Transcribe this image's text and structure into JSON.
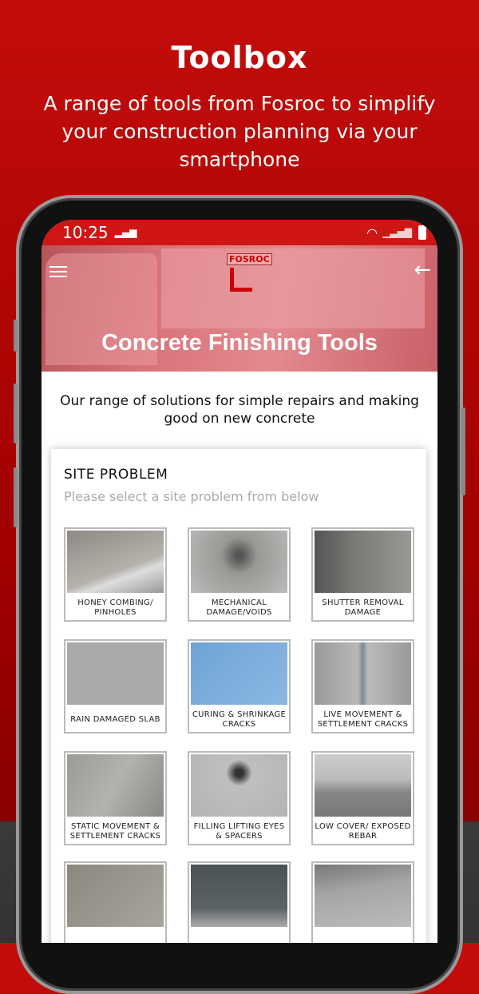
{
  "promo": {
    "title": "Toolbox",
    "subtitle": "A range of tools from Fosroc to simplify your construction planning via your smartphone"
  },
  "status_bar": {
    "time": "10:25"
  },
  "header": {
    "title": "Concrete Finishing Tools",
    "logo_text": "FOSROC",
    "menu_icon": "hamburger-icon",
    "back_icon": "arrow-left-icon"
  },
  "intro": "Our range of solutions for simple repairs and making good on new concrete",
  "site_problem": {
    "heading": "SITE PROBLEM",
    "hint": "Please select a site problem from below",
    "items": [
      {
        "label": "HONEY COMBING/ PINHOLES"
      },
      {
        "label": "MECHANICAL DAMAGE/VOIDS"
      },
      {
        "label": "SHUTTER REMOVAL DAMAGE"
      },
      {
        "label": "RAIN DAMAGED SLAB"
      },
      {
        "label": "CURING & SHRINKAGE CRACKS"
      },
      {
        "label": "LIVE MOVEMENT & SETTLEMENT CRACKS"
      },
      {
        "label": "STATIC MOVEMENT & SETTLEMENT CRACKS"
      },
      {
        "label": "FILLING LIFTING EYES & SPACERS"
      },
      {
        "label": "LOW COVER/ EXPOSED REBAR"
      },
      {
        "label": ""
      },
      {
        "label": ""
      },
      {
        "label": ""
      }
    ]
  }
}
